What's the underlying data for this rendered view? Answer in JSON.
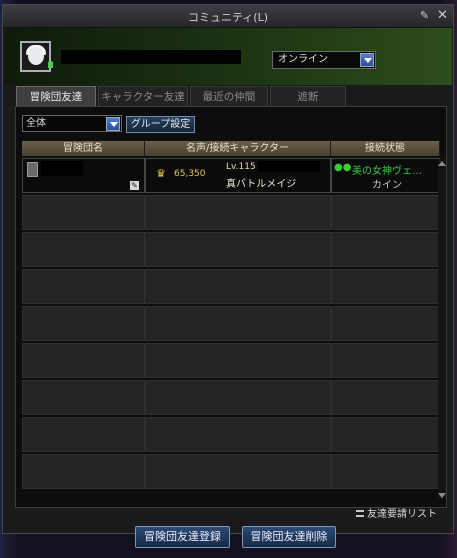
{
  "window": {
    "title": "コミュニティ(L)",
    "pin_icon": "pin-icon",
    "close_icon": "close-icon"
  },
  "profile": {
    "status_value": "オンライン"
  },
  "tabs": [
    {
      "label": "冒険団友達",
      "active": true
    },
    {
      "label": "キャラクター友達",
      "active": false
    },
    {
      "label": "最近の仲間",
      "active": false
    },
    {
      "label": "遮断",
      "active": false
    }
  ],
  "filter": {
    "value": "全体",
    "group_button": "グループ設定"
  },
  "table": {
    "headers": [
      "冒険団名",
      "名声/接続キャラクター",
      "接続状態"
    ],
    "rows": [
      {
        "fame": "65,350",
        "level": "Lv.115",
        "class": "真バトルメイジ",
        "location": "美の女神ヴェ…",
        "channel": "カイン"
      }
    ]
  },
  "footer": {
    "request_list_label": "友達要請リスト",
    "add_button": "冒険団友達登録",
    "delete_button": "冒険団友達削除"
  },
  "colors": {
    "header_gradient": "#2c4d1c",
    "accent_blue": "#2c4f9a",
    "online_green": "#47d04a",
    "table_header": "#6b5f4b"
  }
}
